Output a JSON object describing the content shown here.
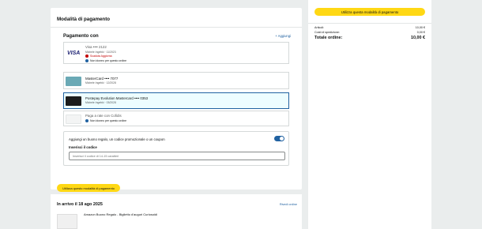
{
  "payment": {
    "section_title": "Modalità di pagamento",
    "pay_with": "Pagamento con",
    "add_link": "+ Aggiungi",
    "cards": [
      {
        "name": "Visa •••• 2122",
        "holder": "Michele Ingebki · 11/2023",
        "note": "Scaduta Aggiorna",
        "note_kind": "error"
      },
      {
        "name": "MasterCard •••• 7077",
        "holder": "Michele Ingebki · 12/2028"
      },
      {
        "name": "Postepay Evolution Mastercard •••• 0353",
        "holder": "Michele Ingebki · 03/2028"
      },
      {
        "name": "Paga a rate con Cofidis",
        "note": "Non idoneo per questo ordine",
        "note_kind": "info"
      }
    ],
    "visa_note_secondary": "Non idoneo per questo ordine",
    "promo_question": "Aggiungi un buono regalo, un codice promozionale o un coupon",
    "code_label": "Inserisci il codice",
    "code_placeholder": "Inserisci il codice di 14-15 caratteri",
    "use_button": "Utilizza questo modalità di pagamento"
  },
  "summary": {
    "use_button": "Utilizza questa modalità di pagamento",
    "items_label": "Articoli:",
    "items_value": "10,00 €",
    "shipping_label": "Costi di spedizione:",
    "shipping_value": "0,00 €",
    "total_label": "Totale ordine:",
    "total_value": "10,00 €"
  },
  "shipment": {
    "date": "In arrivo il 18 ago 2025",
    "review_link": "Rivedi ordine",
    "item": "Amazon Buono Regalo - Biglietto d'auguri Curiosoidi"
  },
  "colors": {
    "accent_yellow": "#ffd814",
    "link_blue": "#2162a1",
    "error_red": "#c40000"
  }
}
